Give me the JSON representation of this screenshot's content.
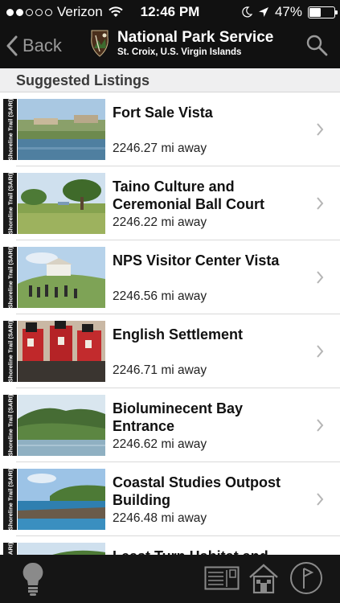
{
  "status_bar": {
    "carrier": "Verizon",
    "time": "12:46 PM",
    "battery": "47%",
    "battery_level": 0.47,
    "signal_bars_filled": 2,
    "signal_bars_total": 5
  },
  "nav": {
    "back_label": "Back",
    "title": "National Park Service",
    "subtitle": "St. Croix, U.S. Virgin Islands"
  },
  "section": {
    "title": "Suggested Listings"
  },
  "listings": [
    {
      "trail_tag": "Shoreline Trail (SARI)",
      "name": "Fort Sale Vista",
      "distance": "2246.27 mi away",
      "thumb": "fort"
    },
    {
      "trail_tag": "Shoreline Trail (SARI)",
      "name": "Taino Culture and Ceremonial Ball Court",
      "distance": "2246.22 mi away",
      "thumb": "field"
    },
    {
      "trail_tag": "Shoreline Trail (SARI)",
      "name": "NPS Visitor Center Vista",
      "distance": "2246.56 mi away",
      "thumb": "hill"
    },
    {
      "trail_tag": "Shoreline Trail (SARI)",
      "name": "English Settlement",
      "distance": "2246.71 mi away",
      "thumb": "redcoats"
    },
    {
      "trail_tag": "Shoreline Trail (SARI)",
      "name": "Bioluminecent Bay Entrance",
      "distance": "2246.62 mi away",
      "thumb": "bay"
    },
    {
      "trail_tag": "Shoreline Trail (SARI)",
      "name": "Coastal Studies Outpost Building",
      "distance": "2246.48 mi away",
      "thumb": "coast"
    },
    {
      "trail_tag": "Shoreline Trail (SARI)",
      "name": "Least Turn Habitat and",
      "distance": "",
      "thumb": "partial"
    }
  ],
  "tab_bar": {
    "items": [
      {
        "icon": "lightbulb-icon"
      },
      {
        "icon": "postcard-icon"
      },
      {
        "icon": "house-icon"
      },
      {
        "icon": "flag-icon"
      }
    ]
  },
  "colors": {
    "bar_background": "#111111",
    "back_text": "#9a9a9a",
    "section_background": "#efeff0",
    "tab_icon": "#8a8a8a"
  }
}
